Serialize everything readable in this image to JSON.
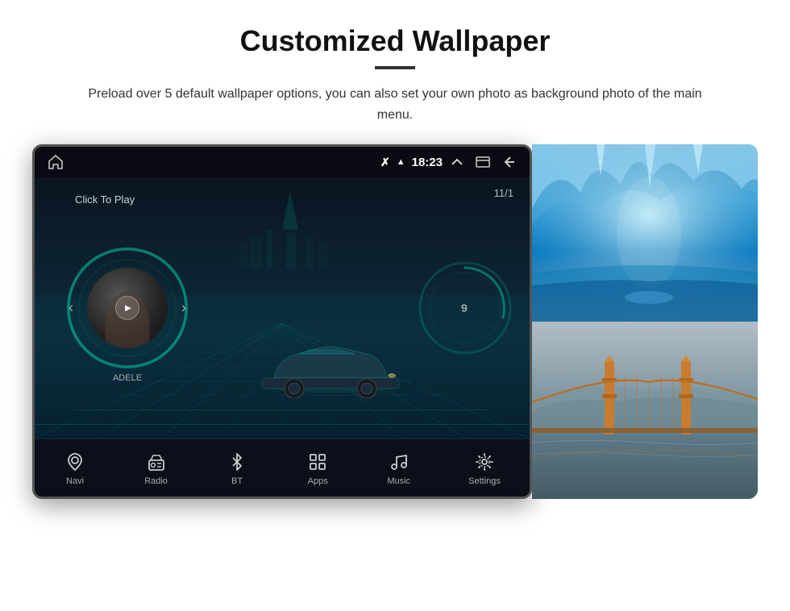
{
  "header": {
    "title": "Customized Wallpaper",
    "description": "Preload over 5 default wallpaper options, you can also set your own photo as background photo of the main menu."
  },
  "device": {
    "status_bar": {
      "time": "18:23",
      "icons": [
        "bluetooth",
        "wifi-signal"
      ]
    },
    "main_screen": {
      "click_to_play": "Click To Play",
      "date": "11/1",
      "artist": "ADELE"
    },
    "bottom_nav": [
      {
        "id": "navi",
        "label": "Navi",
        "icon": "location-pin"
      },
      {
        "id": "radio",
        "label": "Radio",
        "icon": "radio"
      },
      {
        "id": "bt",
        "label": "BT",
        "icon": "bluetooth"
      },
      {
        "id": "apps",
        "label": "Apps",
        "icon": "apps-grid"
      },
      {
        "id": "music",
        "label": "Music",
        "icon": "music-note"
      },
      {
        "id": "settings",
        "label": "Settings",
        "icon": "settings-gear"
      }
    ]
  },
  "thumbnails": [
    {
      "id": "ice-cave",
      "alt": "Ice cave blue wallpaper"
    },
    {
      "id": "golden-gate",
      "alt": "Golden Gate Bridge wallpaper"
    }
  ],
  "colors": {
    "accent": "#00c8a0",
    "nav_bg": "#0a0f19",
    "screen_bg": "#0a1520"
  }
}
